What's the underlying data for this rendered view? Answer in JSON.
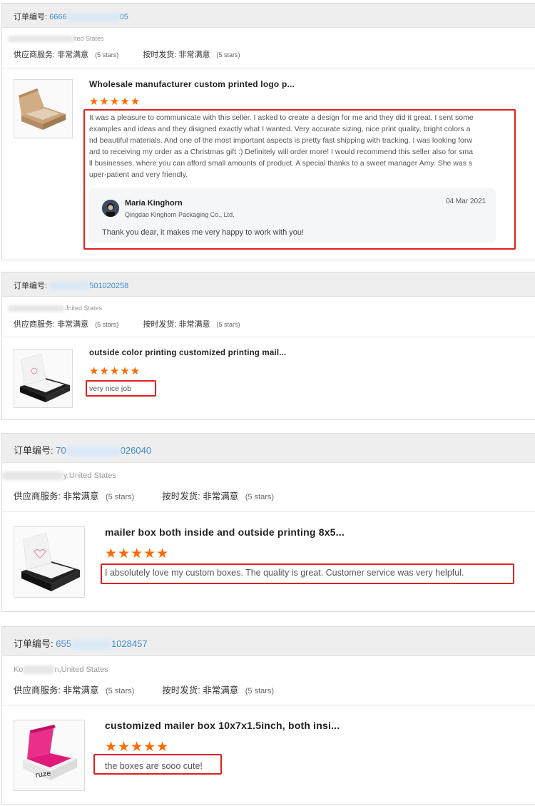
{
  "reviews": [
    {
      "order_label": "订单编号:",
      "order_prefix": "6666",
      "order_suffix": "05",
      "location": "ited States",
      "supplier_label": "供应商服务:",
      "supplier_value": "非常满意",
      "supplier_stars": "(5 stars)",
      "shipping_label": "按时发货:",
      "shipping_value": "非常满意",
      "shipping_stars": "(5 stars)",
      "product_title": "Wholesale manufacturer custom printed logo p...",
      "rating": "★★★★★",
      "review_text": "It was a pleasure to communicate with this seller. I asked to create a design for me and they did it great. I sent some examples and ideas and they disigned exactly what I wanted. Very accurate sizing, nice print quality, bright colors and beautiful materials. And one of the most important aspects is pretty fast shipping with tracking. I was looking forward to receiving my order as a Christmas gift :) Definitely will order more! I would recommend this seller also for small businesses, where you can afford small amounts of product. A special thanks to a sweet manager Amy. She was super-patient and very friendly.",
      "reply": {
        "name": "Maria Kinghorn",
        "company": "Qingdao Kinghorn Packaging Co., Ltd.",
        "date": "04 Mar 2021",
        "text": "Thank you dear, it makes me very happy to work with you!"
      }
    },
    {
      "order_label": "订单编号:",
      "order_prefix": "",
      "order_suffix": "501020258",
      "location": "Jnited States",
      "supplier_label": "供应商服务:",
      "supplier_value": "非常满意",
      "supplier_stars": "(5 stars)",
      "shipping_label": "按时发货:",
      "shipping_value": "非常满意",
      "shipping_stars": "(5 stars)",
      "product_title": "outside color printing customized printing mail...",
      "rating": "★★★★★",
      "review_text": "very nice job"
    },
    {
      "order_label": "订单编号:",
      "order_prefix": "70",
      "order_suffix": "026040",
      "location": "y,United States",
      "supplier_label": "供应商服务:",
      "supplier_value": "非常满意",
      "supplier_stars": "(5 stars)",
      "shipping_label": "按时发货:",
      "shipping_value": "非常满意",
      "shipping_stars": "(5 stars)",
      "product_title": "mailer box both inside and outside printing 8x5...",
      "rating": "★★★★★",
      "review_text": "I absolutely love my custom boxes. The quality is great. Customer service was very helpful."
    },
    {
      "order_label": "订单编号:",
      "order_prefix": "655",
      "order_suffix": "1028457",
      "location": "n,United States",
      "location_prefix": "Ko",
      "supplier_label": "供应商服务:",
      "supplier_value": "非常满意",
      "supplier_stars": "(5 stars)",
      "shipping_label": "按时发货:",
      "shipping_value": "非常满意",
      "shipping_stars": "(5 stars)",
      "product_title": "customized mailer box 10x7x1.5inch, both insi...",
      "rating": "★★★★★",
      "review_text": "the boxes are sooo cute!",
      "thumb_brand": "ruze"
    }
  ],
  "colors": {
    "accent_link": "#3a8ad8",
    "star": "#ff6a00",
    "highlight": "#e02020",
    "header_bg": "#eeeeee"
  }
}
